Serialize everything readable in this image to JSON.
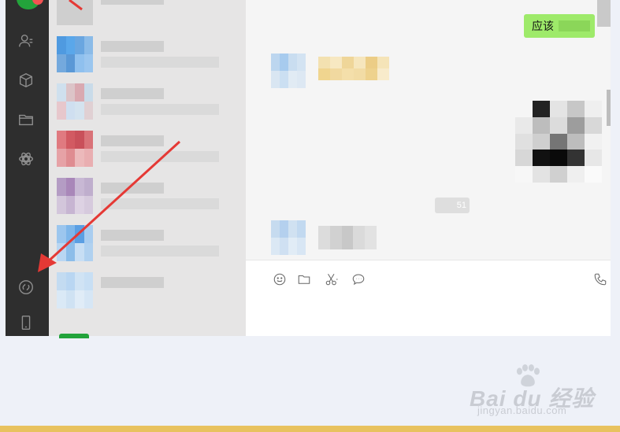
{
  "sidebar": {
    "icons": [
      "avatar-badge",
      "contacts-icon",
      "box-icon",
      "folder-icon",
      "mini-program-icon",
      "moments-link-icon",
      "phone-device-icon"
    ]
  },
  "conversations": [
    {
      "avatar_color": "#6aa6e0"
    },
    {
      "avatar_color": "#d9a9b1"
    },
    {
      "avatar_color": "#d25a62"
    },
    {
      "avatar_color": "#a987b9"
    },
    {
      "avatar_color": "#7eb6ea"
    },
    {
      "avatar_color": "#b9d6f2"
    }
  ],
  "chat": {
    "outgoing_message": "应该",
    "time_chip": "51",
    "toolbar": [
      "emoji-icon",
      "folder-icon",
      "scissors-icon",
      "chat-bubble-icon",
      "phone-icon"
    ]
  },
  "watermark": {
    "brand": "Bai du 经验",
    "url": "jingyan.baidu.com"
  },
  "colors": {
    "sidebar": "#2e2e2e",
    "bubble": "#9eea6a",
    "accent_green": "#22a33a",
    "arrow": "#e53935"
  }
}
